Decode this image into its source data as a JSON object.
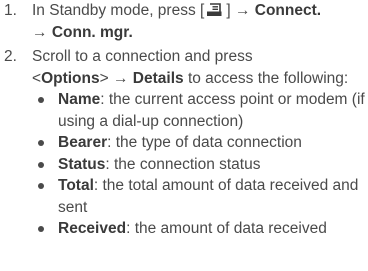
{
  "steps": [
    {
      "number": "1.",
      "prefix": "In Standby mode, press [",
      "menu_key_icon": "menu-key-icon",
      "mid": "] → ",
      "bold1": "Connect.",
      "arrow2": "→ ",
      "bold2": "Conn. mgr."
    },
    {
      "number": "2.",
      "line1": "Scroll to a connection and press",
      "lt": "<",
      "options": "Options",
      "gt": "> → ",
      "details": "Details",
      "rest": " to access the following:",
      "items": [
        {
          "term": "Name",
          "desc": ": the current access point or modem (if using a dial-up connection)"
        },
        {
          "term": "Bearer",
          "desc": ": the type of data connection"
        },
        {
          "term": "Status",
          "desc": ": the connection status"
        },
        {
          "term": "Total",
          "desc": ": the total amount of data received and sent"
        },
        {
          "term": "Received",
          "desc": ": the amount of data received"
        }
      ]
    }
  ]
}
